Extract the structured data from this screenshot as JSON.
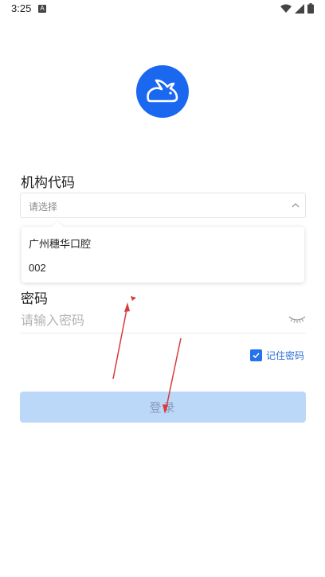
{
  "status_bar": {
    "time": "3:25",
    "notification_glyph": "A",
    "icons": [
      "wifi-icon",
      "signal-icon",
      "battery-icon"
    ]
  },
  "app": {
    "logo_icon": "rabbit-logo-icon",
    "brand_color": "#1a67f0"
  },
  "form": {
    "org_label": "机构代码",
    "org_select": {
      "placeholder": "请选择",
      "options": [
        "广州穗华口腔",
        "002"
      ]
    },
    "password_label": "密码",
    "password_placeholder": "请输入密码",
    "remember": {
      "label": "记住密码",
      "checked": true
    },
    "login_button": "登录"
  },
  "colors": {
    "accent": "#2672ec",
    "button_disabled": "#bcd8f8",
    "annotation_arrow": "#d93a3a"
  }
}
